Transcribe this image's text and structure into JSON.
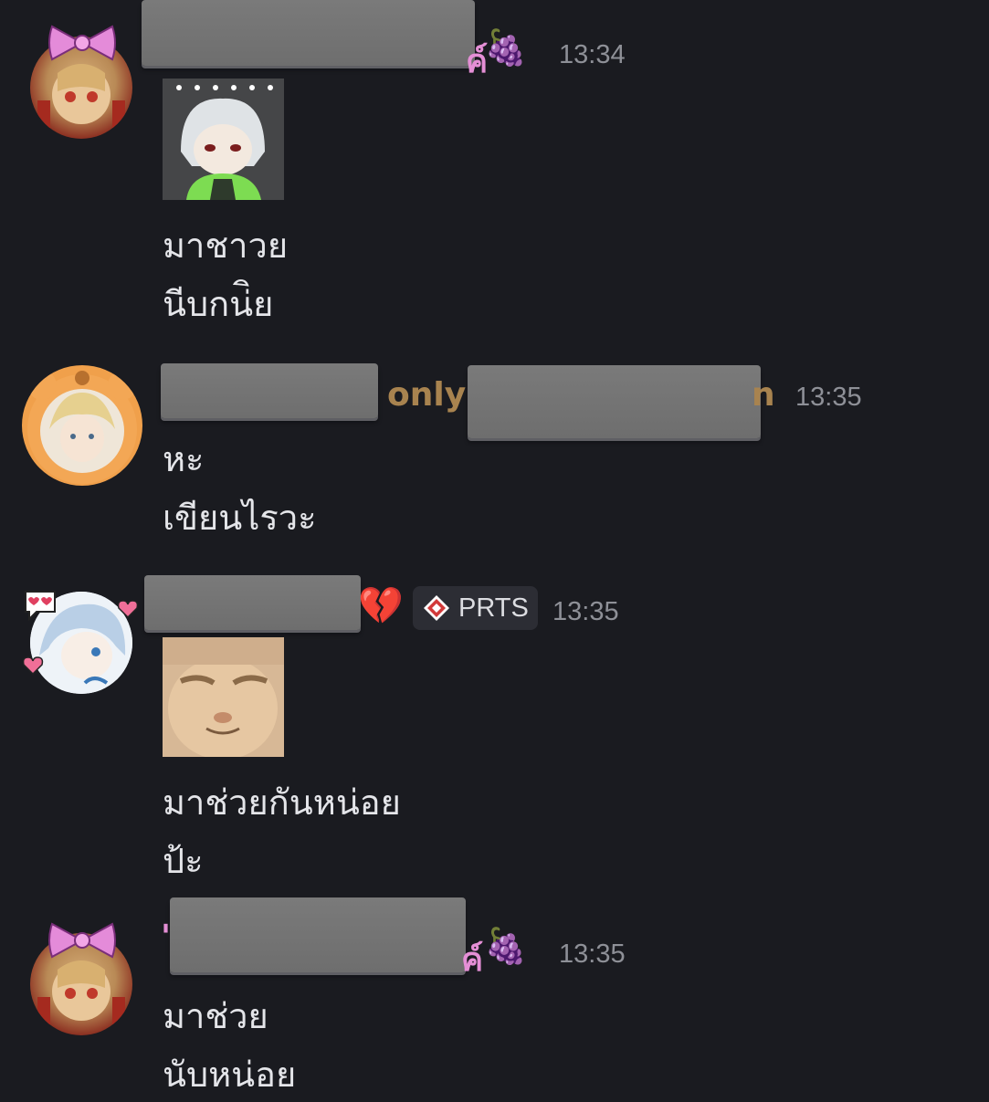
{
  "messages": [
    {
      "name_suffix": "ค์",
      "name_emoji": "🍇",
      "time": "13:34",
      "lines": [
        "มาชาวย",
        "นีบกน่ิย"
      ],
      "avatar_icon": "ribbon-doll-avatar",
      "sticker": "chibi-white-hair-sticker"
    },
    {
      "name_suffix": "only",
      "name_tail": "n",
      "time": "13:35",
      "lines": [
        "หะ",
        "เขียนไรวะ"
      ],
      "avatar_icon": "bear-donut-frame-avatar"
    },
    {
      "name_emoji": "💔",
      "badge_label": "PRTS",
      "badge_icon": "diamond-icon",
      "time": "13:35",
      "lines": [
        "มาช่วยกันหน่อย",
        "ป้ะ"
      ],
      "avatar_icon": "heart-eyes-avatar",
      "sticker": "orange-cat-sticker"
    },
    {
      "name_prefix": "'",
      "name_suffix": "ค์",
      "name_emoji": "🍇",
      "time": "13:35",
      "lines": [
        "มาช่วย",
        "นับหน่อย"
      ],
      "avatar_icon": "ribbon-doll-avatar"
    }
  ],
  "colors": {
    "background": "#1a1b20",
    "name_pink": "#e58fd6",
    "name_gold": "#a8834f",
    "timestamp": "#8e9097",
    "text": "#e4e5e9"
  }
}
